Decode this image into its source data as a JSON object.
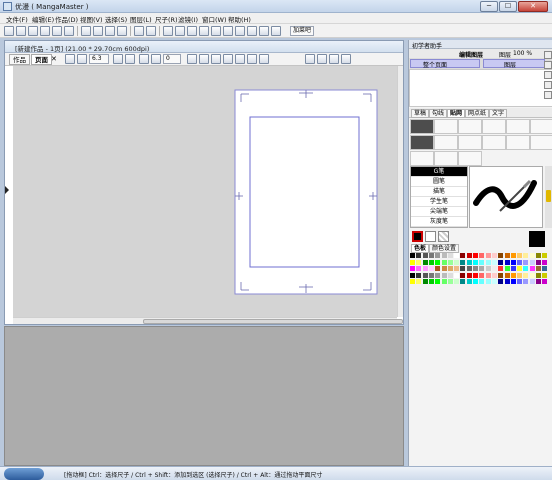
{
  "app": {
    "title": "优漫 ( MangaMaster )"
  },
  "window_buttons": {
    "minimize": "─",
    "maximize": "☐",
    "close": "✕"
  },
  "menu": [
    "文件(F)",
    "编辑(E)",
    "作品(D)",
    "视图(V)",
    "选择(S)",
    "图层(L)",
    "尺子(R)",
    "滤镜(I)",
    "窗口(W)",
    "帮助(H)"
  ],
  "toolbar": {
    "zoom_value": "6.3",
    "rotate_value": "0",
    "extra_label": "加菜吧"
  },
  "document": {
    "title": "[新建作品 - 1页] (21.00 * 29.70cm 600dpi)",
    "tabs": [
      "作品",
      "页面"
    ],
    "close_glyph": "✕"
  },
  "right_panel": {
    "header": "初学者助手",
    "layer_section_label": "编辑图层",
    "layer_label": "图层",
    "opacity": "100 %",
    "layer_left_item": "整个页面",
    "layer_right_item": "图层",
    "tool_tabs": [
      "草稿",
      "勾线",
      "贴网",
      "网点纸",
      "文字"
    ],
    "active_tool_tab": "贴网",
    "brushes": [
      "G笔",
      "圆笔",
      "描笔",
      "学生笔",
      "尖端笔",
      "灰度笔"
    ],
    "selected_brush": "G笔",
    "color_tabs": [
      "色板",
      "颜色设置"
    ]
  },
  "colors": {
    "accent": "#8a8ad3",
    "fg_color": "#000000",
    "bg_color": "#ffffff"
  },
  "status": {
    "text": "[拖动框] Ctrl：选择尺子 / Ctrl + Shift：添加到选区 (选择尺子) / Ctrl + Alt：通过拖动平面尺寸"
  }
}
